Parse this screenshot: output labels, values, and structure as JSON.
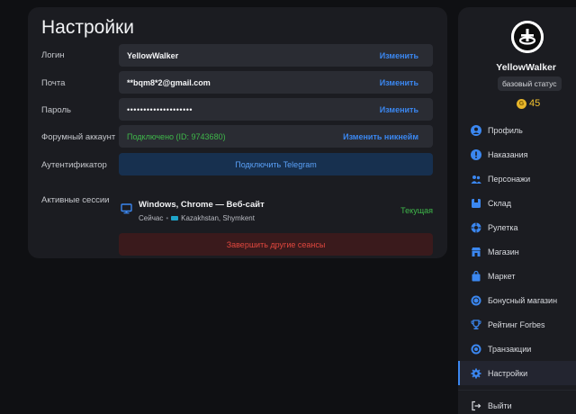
{
  "settings": {
    "title": "Настройки",
    "rows": [
      {
        "label": "Логин",
        "value": "YellowWalker",
        "action": "Изменить"
      },
      {
        "label": "Почта",
        "value": "**bqm8*2@gmail.com",
        "action": "Изменить"
      },
      {
        "label": "Пароль",
        "value": "••••••••••••••••••••",
        "action": "Изменить"
      },
      {
        "label": "Форумный аккаунт",
        "value": "Подключено (ID: 9743680)",
        "action": "Изменить никнейм"
      }
    ],
    "authenticator": {
      "label": "Аутентификатор",
      "button": "Подключить Telegram"
    },
    "sessions": {
      "label": "Активные сессии",
      "device": "Windows, Chrome — Веб-сайт",
      "time": "Сейчас",
      "location": "Kazakhstan, Shymkent",
      "current": "Текущая",
      "end_button": "Завершить другие сеансы"
    }
  },
  "profile": {
    "username": "YellowWalker",
    "status": "базовый статус",
    "balance": "45",
    "coin_symbol": "G"
  },
  "nav": [
    {
      "label": "Профиль",
      "icon": "user-icon"
    },
    {
      "label": "Наказания",
      "icon": "alert-icon"
    },
    {
      "label": "Персонажи",
      "icon": "characters-icon"
    },
    {
      "label": "Склад",
      "icon": "box-icon"
    },
    {
      "label": "Рулетка",
      "icon": "roulette-icon"
    },
    {
      "label": "Магазин",
      "icon": "shop-icon"
    },
    {
      "label": "Маркет",
      "icon": "market-icon"
    },
    {
      "label": "Бонусный магазин",
      "icon": "bonus-icon"
    },
    {
      "label": "Рейтинг Forbes",
      "icon": "trophy-icon"
    },
    {
      "label": "Транзакции",
      "icon": "transactions-icon"
    },
    {
      "label": "Настройки",
      "icon": "gear-icon",
      "active": true
    }
  ],
  "logout": "Выйти",
  "colors": {
    "accent": "#3b87f0",
    "success": "#3fb84a",
    "danger": "#e0473e",
    "coin": "#f2c230"
  }
}
